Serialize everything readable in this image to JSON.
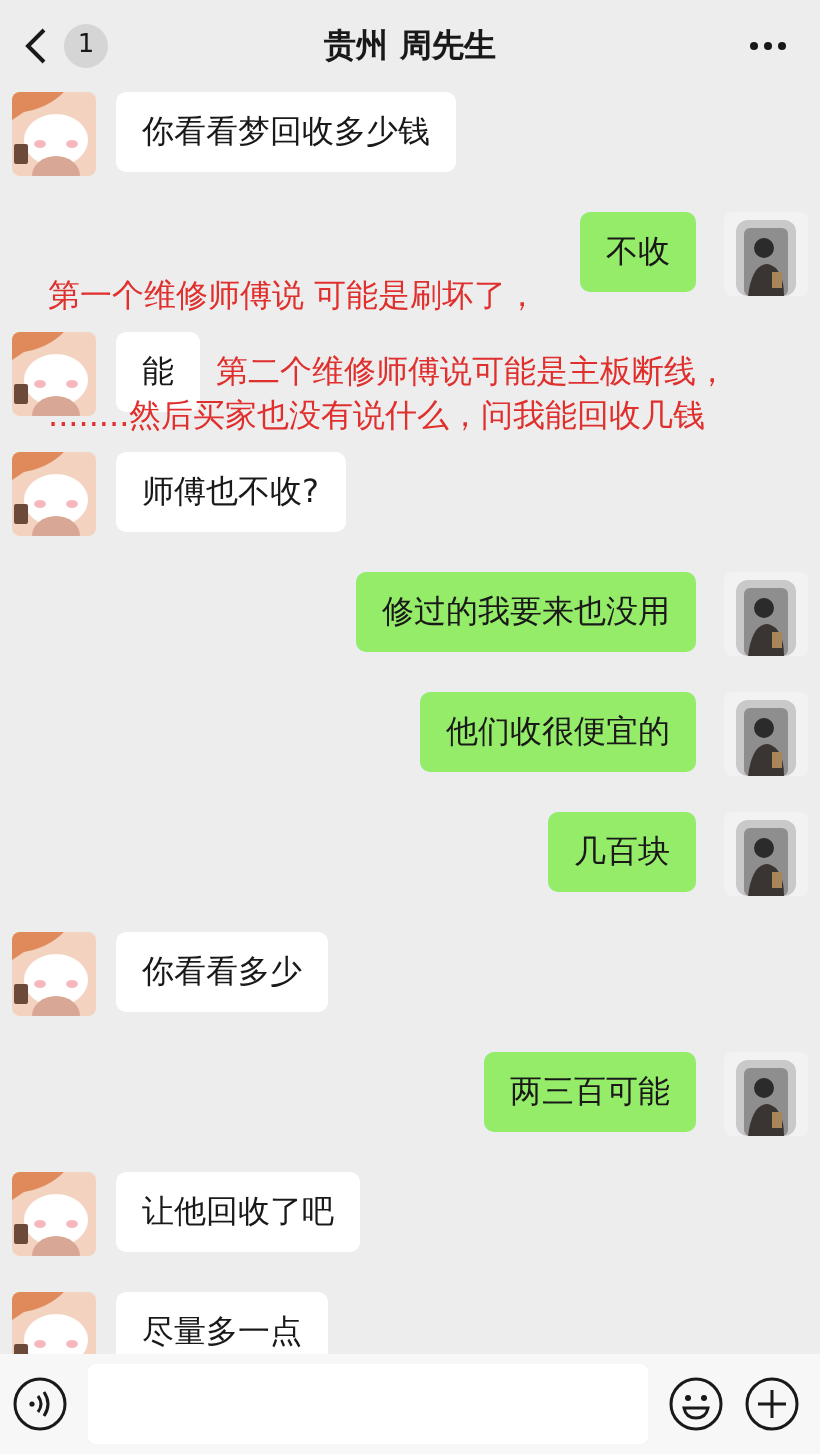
{
  "header": {
    "title": "贵州 周先生",
    "unread": "1"
  },
  "messages": [
    {
      "kind": "received",
      "text": "你看看梦回收多少钱"
    },
    {
      "kind": "sent",
      "text": "不收"
    },
    {
      "kind": "note",
      "text": "第一个维修师傅说 可能是刷坏了，"
    },
    {
      "kind": "received",
      "text": "能",
      "note": "第二个维修师傅说可能是主板断线，"
    },
    {
      "kind": "note",
      "text": "........然后买家也没有说什么，问我能回收几钱"
    },
    {
      "kind": "received",
      "text": "师傅也不收?"
    },
    {
      "kind": "sent",
      "text": "修过的我要来也没用"
    },
    {
      "kind": "sent",
      "text": "他们收很便宜的"
    },
    {
      "kind": "sent",
      "text": "几百块"
    },
    {
      "kind": "received",
      "text": "你看看多少"
    },
    {
      "kind": "sent",
      "text": "两三百可能"
    },
    {
      "kind": "received",
      "text": "让他回收了吧"
    },
    {
      "kind": "received",
      "text": "尽量多一点"
    }
  ]
}
